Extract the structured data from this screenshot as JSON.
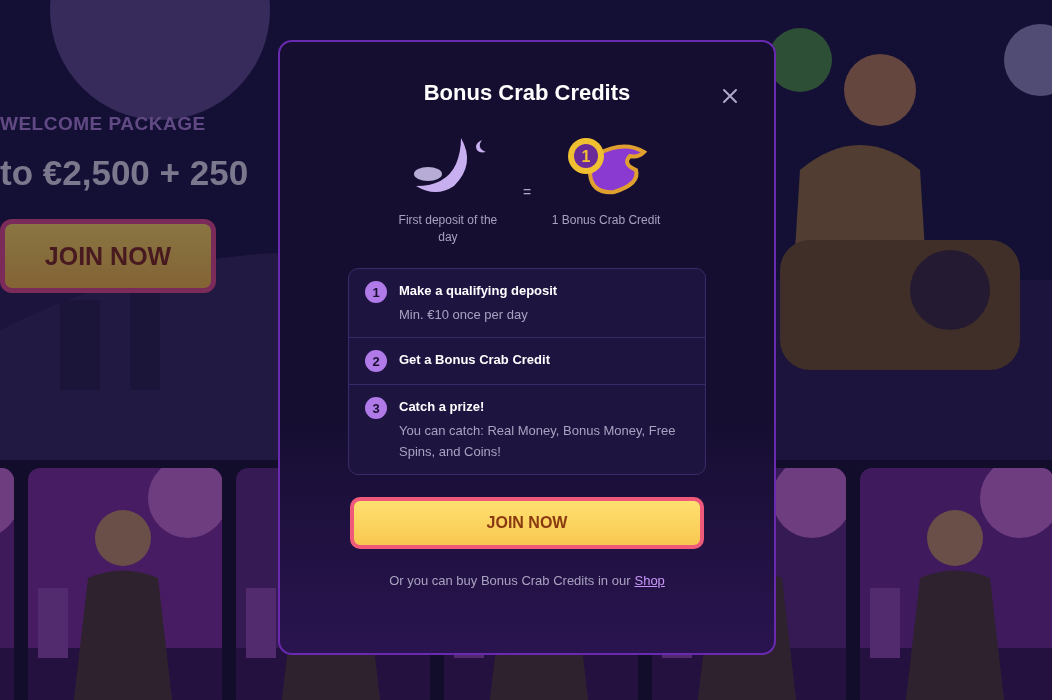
{
  "background": {
    "hero": {
      "kind": "picture",
      "eyebrow": "WELCOME PACKAGE",
      "headline": "to €2,500 + 250",
      "button": "JOIN NOW"
    }
  },
  "modal": {
    "title": "Bonus Crab Credits",
    "exchange": {
      "left_caption": "First deposit of the day",
      "equals": "=",
      "coin_number": "1",
      "right_caption": "1 Bonus Crab Credit"
    },
    "steps": [
      {
        "number": "1",
        "title": "Make a qualifying deposit",
        "detail": "Min. €10 once per day"
      },
      {
        "number": "2",
        "title": "Get a Bonus Crab Credit"
      },
      {
        "number": "3",
        "title": "Catch a prize!",
        "detail": "You can catch: Real Money, Bonus Money, Free Spins, and Coins!"
      }
    ],
    "button": "JOIN NOW",
    "footer": {
      "text": "Or you can buy Bonus Crab Credits in our",
      "link": "Shop"
    }
  }
}
